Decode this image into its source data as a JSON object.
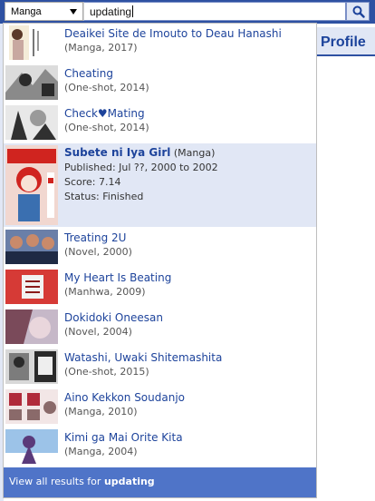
{
  "search": {
    "type_selected": "Manga",
    "query": "updating"
  },
  "header": {
    "profile_tab": "Profile"
  },
  "results": [
    {
      "title": "Deaikei Site de Imouto to Deau Hanashi",
      "meta": "(Manga, 2017)",
      "thumb_colors": [
        "#f4ecd8",
        "#5a3a2a",
        "#c8a8a0"
      ]
    },
    {
      "title": "Cheating",
      "meta": "(One-shot, 2014)",
      "thumb_colors": [
        "#dcdcdc",
        "#2a2a2a",
        "#8a8a8a"
      ]
    },
    {
      "title": "Check♥Mating",
      "meta": "(One-shot, 2014)",
      "thumb_colors": [
        "#e8e8e8",
        "#303030",
        "#9a9a9a"
      ]
    },
    {
      "title": "Subete ni Iya Girl",
      "type": "(Manga)",
      "published": "Published: Jul ??, 2000 to 2002",
      "score": "Score: 7.14",
      "status": "Status: Finished",
      "thumb_colors": [
        "#f1d7d0",
        "#d0241f",
        "#3a6fb0"
      ]
    },
    {
      "title": "Treating 2U",
      "meta": "(Novel, 2000)",
      "thumb_colors": [
        "#6a7fa8",
        "#1f2a44",
        "#c98a6a"
      ]
    },
    {
      "title": "My Heart Is Beating",
      "meta": "(Manhwa, 2009)",
      "thumb_colors": [
        "#d63a36",
        "#f2f2f2",
        "#8a1a1a"
      ]
    },
    {
      "title": "Dokidoki Oneesan",
      "meta": "(Novel, 2004)",
      "thumb_colors": [
        "#c6b8c8",
        "#7a4a5a",
        "#e9d6dc"
      ]
    },
    {
      "title": "Watashi, Uwaki Shitemashita",
      "meta": "(One-shot, 2015)",
      "thumb_colors": [
        "#d8d8d8",
        "#2a2a2a",
        "#7c7c7c"
      ]
    },
    {
      "title": "Aino Kekkon Soudanjo",
      "meta": "(Manga, 2010)",
      "thumb_colors": [
        "#f2e6e6",
        "#b02a3a",
        "#8a6a6a"
      ]
    },
    {
      "title": "Kimi ga Mai Orite Kita",
      "meta": "(Manga, 2004)",
      "thumb_colors": [
        "#9cc3e8",
        "#ffffff",
        "#5a3a7a"
      ]
    }
  ],
  "view_all": {
    "prefix": "View all results for",
    "query": "updating"
  },
  "colors": {
    "brand": "#2e51a2",
    "link": "#1d439b",
    "highlight": "#e1e7f5",
    "view_all_bg": "#4f74c8"
  }
}
